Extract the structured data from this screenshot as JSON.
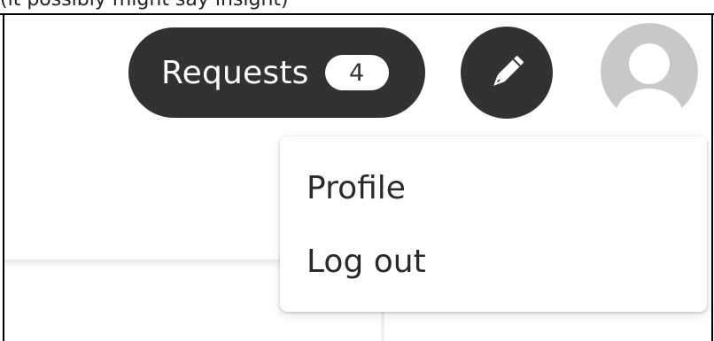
{
  "page_top_text": "(it possibly might say insight)",
  "header": {
    "requests_label": "Requests",
    "requests_count": "4",
    "edit_icon": "pencil-icon",
    "avatar_icon": "default-avatar-icon"
  },
  "dropdown": {
    "items": [
      {
        "label": "Profile"
      },
      {
        "label": "Log out"
      }
    ]
  },
  "colors": {
    "dark_button": "#323232",
    "badge_background": "#ffffff",
    "avatar_gray": "#c8c8c8",
    "menu_text": "#2a2a2a"
  }
}
